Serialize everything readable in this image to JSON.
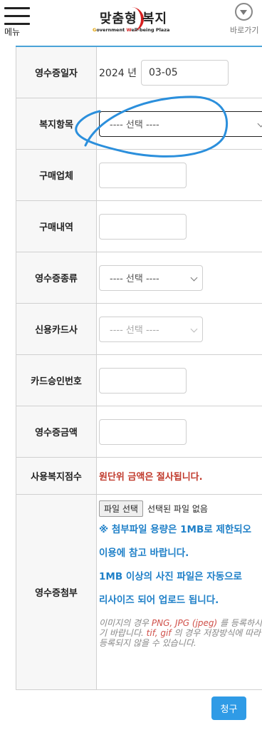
{
  "header": {
    "menu_label": "메뉴",
    "logo_main": "맞춤형 복지",
    "logo_sub_g": "G",
    "logo_sub_1": "overnment ",
    "logo_sub_w": "W",
    "logo_sub_2": "ell-being Plaza",
    "shortcut_label": "바로가기"
  },
  "form": {
    "receipt_date": {
      "label": "영수증일자",
      "year": "2024 년",
      "value": "03-05"
    },
    "welfare_item": {
      "label": "복지항목",
      "selected": "---- 선택 ----"
    },
    "vendor": {
      "label": "구매업체",
      "value": ""
    },
    "purchase_detail": {
      "label": "구매내역",
      "value": ""
    },
    "receipt_type": {
      "label": "영수증종류",
      "selected": "---- 선택 ----"
    },
    "card_company": {
      "label": "신용카드사",
      "selected": "---- 선택 ----"
    },
    "approval_no": {
      "label": "카드승인번호",
      "value": ""
    },
    "amount": {
      "label": "영수증금액",
      "value": ""
    },
    "points_used": {
      "label": "사용복지점수",
      "notice": "원단위 금액은 절사됩니다."
    },
    "attachment": {
      "label": "영수증첨부",
      "file_button": "파일 선택",
      "file_status": "선택된 파일 없음",
      "notice_1": "※ 첨부파일 용량은 1MB로 제한되오",
      "notice_2": "이용에 참고 바랍니다.",
      "notice_3": "1MB 이상의 사진 파일은 자동으로",
      "notice_4": "리사이즈 되어 업로드 됩니다.",
      "note_a": "이미지의 경우 ",
      "note_formats": "PNG, JPG (jpeg)",
      "note_b": " 를 등록하시기 바랍니다. ",
      "note_other": "tif, gif",
      "note_c": " 의 경우 저장방식에 따라 등록되지 않을 수 있습니다."
    }
  },
  "submit_label": "청구",
  "colors": {
    "accent": "#2f9be6",
    "notice_red": "#c0392b",
    "info_blue": "#1f80c8"
  }
}
